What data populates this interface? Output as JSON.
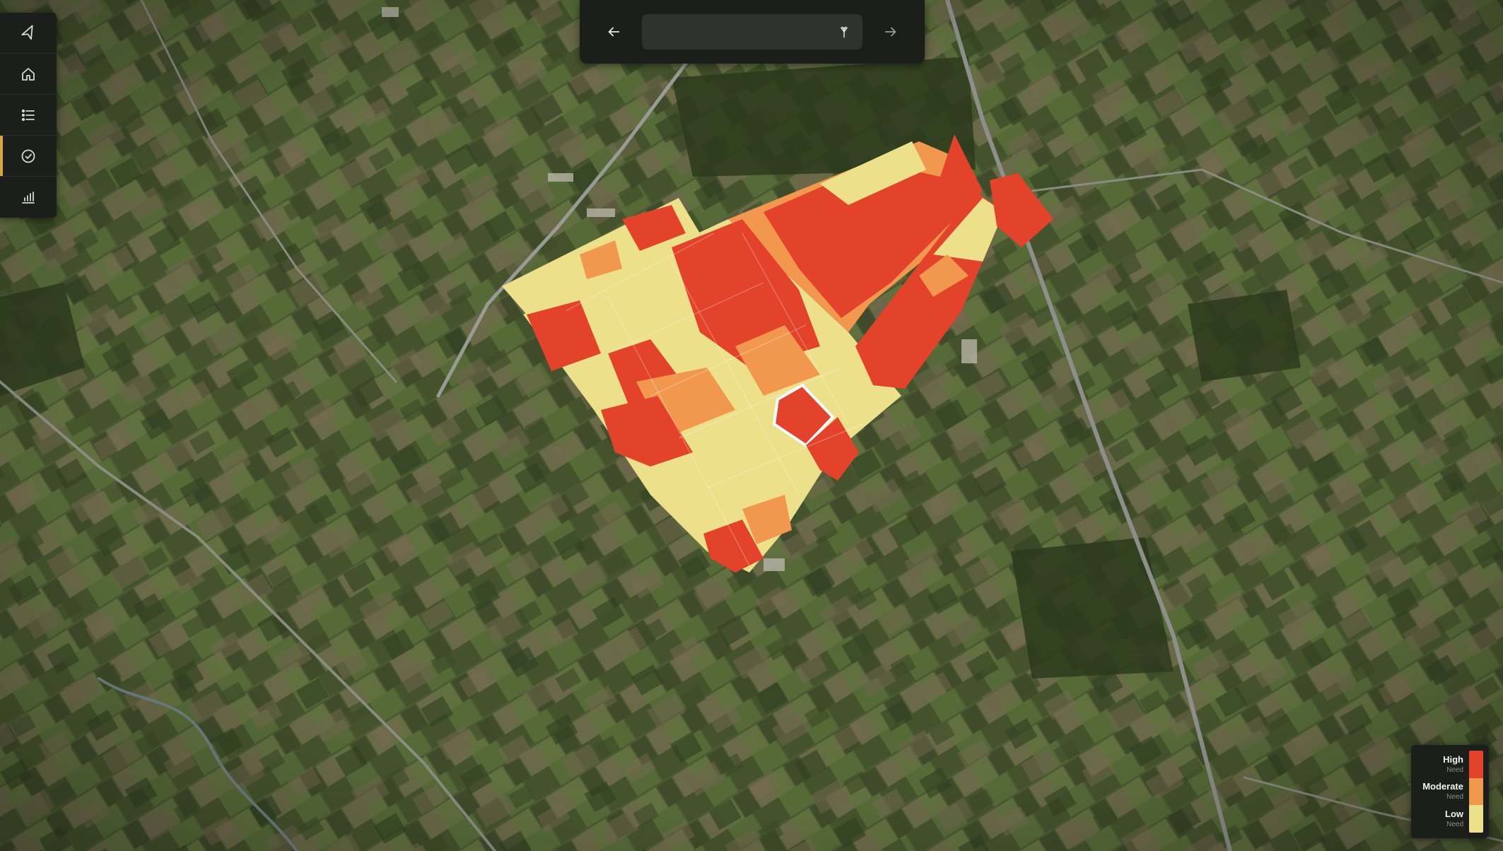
{
  "nav": {
    "prev_icon": "arrow-left-icon",
    "next_icon": "arrow-right-icon",
    "date_value": "",
    "filter_icon": "tree-icon"
  },
  "toolbar": {
    "items": [
      {
        "id": "navigate",
        "icon": "navigation-icon",
        "active": false
      },
      {
        "id": "home",
        "icon": "home-icon",
        "active": false
      },
      {
        "id": "list",
        "icon": "list-icon",
        "active": false
      },
      {
        "id": "check",
        "icon": "check-circle-icon",
        "active": true
      },
      {
        "id": "analytics",
        "icon": "bar-chart-icon",
        "active": false
      }
    ]
  },
  "legend": {
    "items": [
      {
        "label": "High",
        "sub": "Need",
        "color": "#e2432a"
      },
      {
        "label": "Moderate",
        "sub": "Need",
        "color": "#f2984e"
      },
      {
        "label": "Low",
        "sub": "Need",
        "color": "#ece08a"
      }
    ]
  },
  "colors": {
    "high": "#e2432a",
    "moderate": "#f2984e",
    "low": "#ece08a",
    "accent": "#d9a441",
    "panel": "#1c1e1b",
    "selected_outline": "#ffffff"
  }
}
